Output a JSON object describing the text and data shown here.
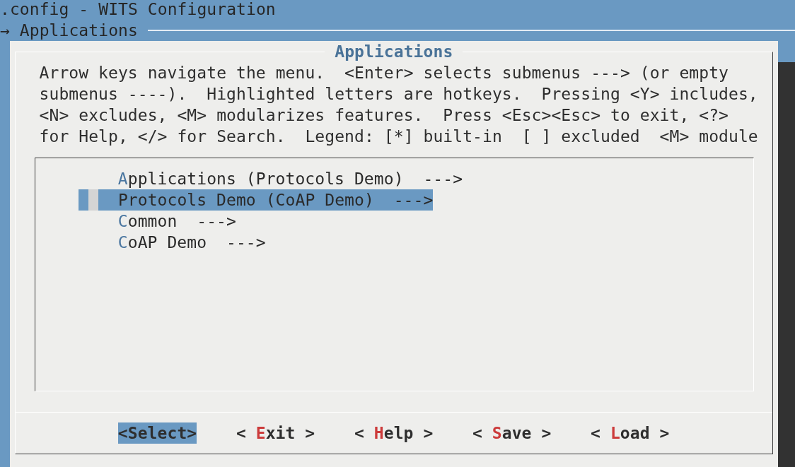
{
  "window": {
    "title": ".config - WITS Configuration"
  },
  "breadcrumb": "→ Applications",
  "dialog": {
    "title": "Applications",
    "help_lines": [
      "Arrow keys navigate the menu.  <Enter> selects submenus ---> (or empty",
      "submenus ----).  Highlighted letters are hotkeys.  Pressing <Y> includes,",
      "<N> excludes, <M> modularizes features.  Press <Esc><Esc> to exit, <?>",
      "for Help, </> for Search.  Legend: [*] built-in  [ ] excluded  <M> module"
    ],
    "menu": {
      "items": [
        {
          "label": "Applications (Protocols Demo)  --->",
          "selected": false
        },
        {
          "label": "Protocols Demo (CoAP Demo)  --->",
          "selected": true
        },
        {
          "label": "Common  --->",
          "selected": false
        },
        {
          "label": "CoAP Demo  --->",
          "selected": false
        }
      ]
    },
    "buttons": [
      {
        "label": "<Select>",
        "selected": true
      },
      {
        "label": "< Exit >",
        "selected": false
      },
      {
        "label": "< Help >",
        "selected": false
      },
      {
        "label": "< Save >",
        "selected": false
      },
      {
        "label": "< Load >",
        "selected": false
      }
    ]
  }
}
